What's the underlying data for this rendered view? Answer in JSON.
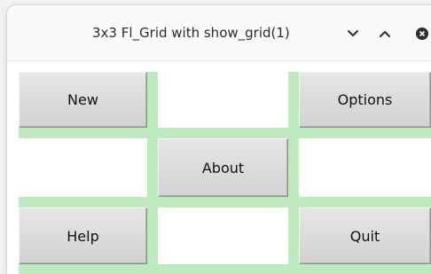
{
  "window": {
    "title": "3x3 Fl_Grid with show_grid(1)"
  },
  "titlebar_buttons": [
    {
      "name": "minimize",
      "icon": "chevron-down-icon"
    },
    {
      "name": "maximize",
      "icon": "chevron-up-icon"
    },
    {
      "name": "close",
      "icon": "close-icon"
    }
  ],
  "grid": {
    "rows": 3,
    "columns": 3,
    "grid_color": "#bfeabf",
    "buttons": {
      "new": "New",
      "options": "Options",
      "about": "About",
      "help": "Help",
      "quit": "Quit"
    }
  }
}
